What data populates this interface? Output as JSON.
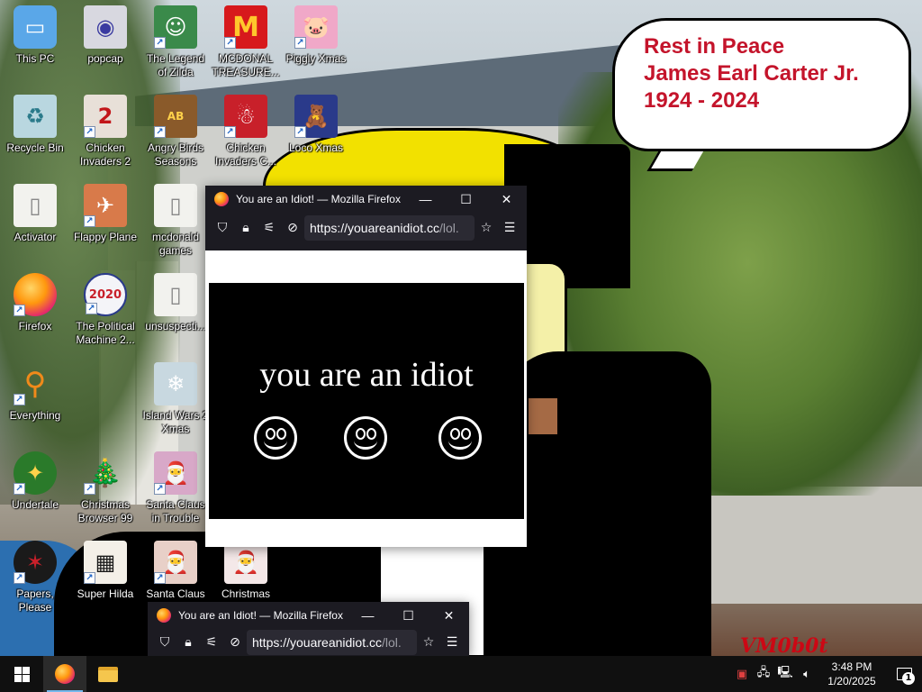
{
  "bubble": {
    "line1": "Rest in Peace",
    "line2": "James Earl Carter Jr.",
    "line3": "1924 - 2024"
  },
  "watermark": "VM0b0t",
  "desktop_icons": [
    {
      "label": "This PC",
      "icon": "this-pc-icon"
    },
    {
      "label": "popcap",
      "icon": "popcap-icon"
    },
    {
      "label": "The Legend of Zilda",
      "icon": "legend-of-zilda-icon"
    },
    {
      "label": "MCDONAL TREASURE...",
      "icon": "mcdonald-treasure-icon"
    },
    {
      "label": "Piggly Xmas",
      "icon": "piggly-xmas-icon"
    },
    {
      "label": "Recycle Bin",
      "icon": "recycle-bin-icon"
    },
    {
      "label": "Chicken Invaders 2",
      "icon": "chicken-invaders-2-icon"
    },
    {
      "label": "Angry Birds Seasons",
      "icon": "angry-birds-seasons-icon"
    },
    {
      "label": "Chicken Invaders C...",
      "icon": "chicken-invaders-c-icon"
    },
    {
      "label": "Loco Xmas",
      "icon": "loco-xmas-icon"
    },
    {
      "label": "Activator",
      "icon": "activator-icon"
    },
    {
      "label": "Flappy Plane",
      "icon": "flappy-plane-icon"
    },
    {
      "label": "mcdonald games",
      "icon": "mcdonald-games-icon"
    },
    {
      "label": "Firefox",
      "icon": "firefox-icon"
    },
    {
      "label": "The Political Machine 2...",
      "icon": "political-machine-icon"
    },
    {
      "label": "unsuspecti...",
      "icon": "unsuspecti-icon"
    },
    {
      "label": "Everything",
      "icon": "everything-search-icon"
    },
    {
      "label": "Island Wars 2 Xmas",
      "icon": "island-wars-2-icon"
    },
    {
      "label": "Undertale",
      "icon": "undertale-icon"
    },
    {
      "label": "Christmas Browser 99",
      "icon": "christmas-browser-99-icon"
    },
    {
      "label": "Santa Claus in Trouble",
      "icon": "santa-claus-trouble-icon"
    },
    {
      "label": "Papers, Please",
      "icon": "papers-please-icon"
    },
    {
      "label": "Super Hilda",
      "icon": "super-hilda-icon"
    },
    {
      "label": "Santa Claus in",
      "icon": "santa-claus-in-icon"
    },
    {
      "label": "Christmas Eve",
      "icon": "christmas-eve-icon"
    }
  ],
  "firefox_main": {
    "title": "You are an Idiot! — Mozilla Firefox",
    "url_host": "https://youareanidiot.cc",
    "url_path": "/lol.",
    "page_text": "you are an idiot"
  },
  "firefox_second": {
    "title": "You are an Idiot! — Mozilla Firefox",
    "url_host": "https://youareanidiot.cc",
    "url_path": "/lol."
  },
  "window_controls": {
    "minimize": "—",
    "maximize": "☐",
    "close": "✕"
  },
  "taskbar": {
    "time": "3:48 PM",
    "date": "1/20/2025",
    "notification_count": "1"
  },
  "colors": {
    "bubble_text": "#c4142b",
    "firefox_chrome": "#1c1b22",
    "taskbar": "#101010"
  }
}
